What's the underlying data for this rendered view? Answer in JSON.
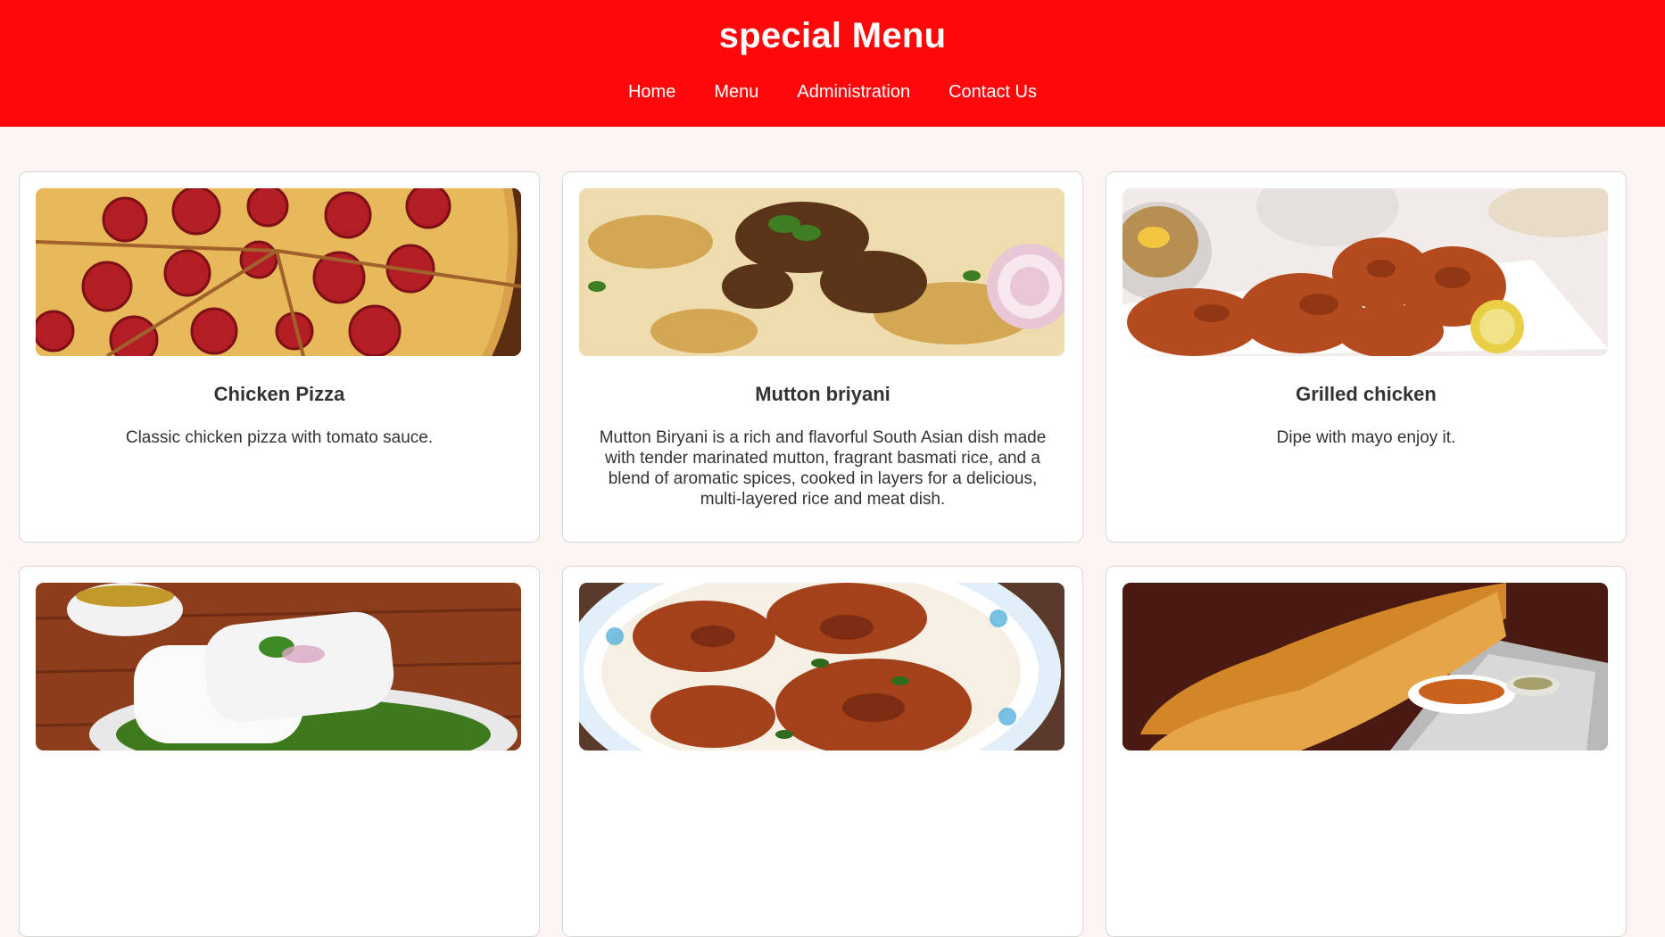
{
  "header": {
    "title": "special Menu",
    "nav": [
      "Home",
      "Menu",
      "Administration",
      "Contact Us"
    ]
  },
  "colors": {
    "header_bg": "#fe080b",
    "page_bg": "#fdf5f1"
  },
  "menu_items": [
    {
      "name": "Chicken Pizza",
      "description": "Classic chicken pizza with tomato sauce.",
      "image": "pepperoni-pizza"
    },
    {
      "name": "Mutton briyani",
      "description": "Mutton Biryani is a rich and flavorful South Asian dish made with tender marinated mutton, fragrant basmati rice, and a blend of aromatic spices, cooked in layers for a delicious, multi-layered rice and meat dish.",
      "image": "mutton-biryani"
    },
    {
      "name": "Grilled chicken",
      "description": "Dipe with mayo enjoy it.",
      "image": "grilled-chicken"
    },
    {
      "name": "",
      "description": "",
      "image": "puttu"
    },
    {
      "name": "",
      "description": "",
      "image": "fried-fish"
    },
    {
      "name": "",
      "description": "",
      "image": "dosa"
    }
  ]
}
